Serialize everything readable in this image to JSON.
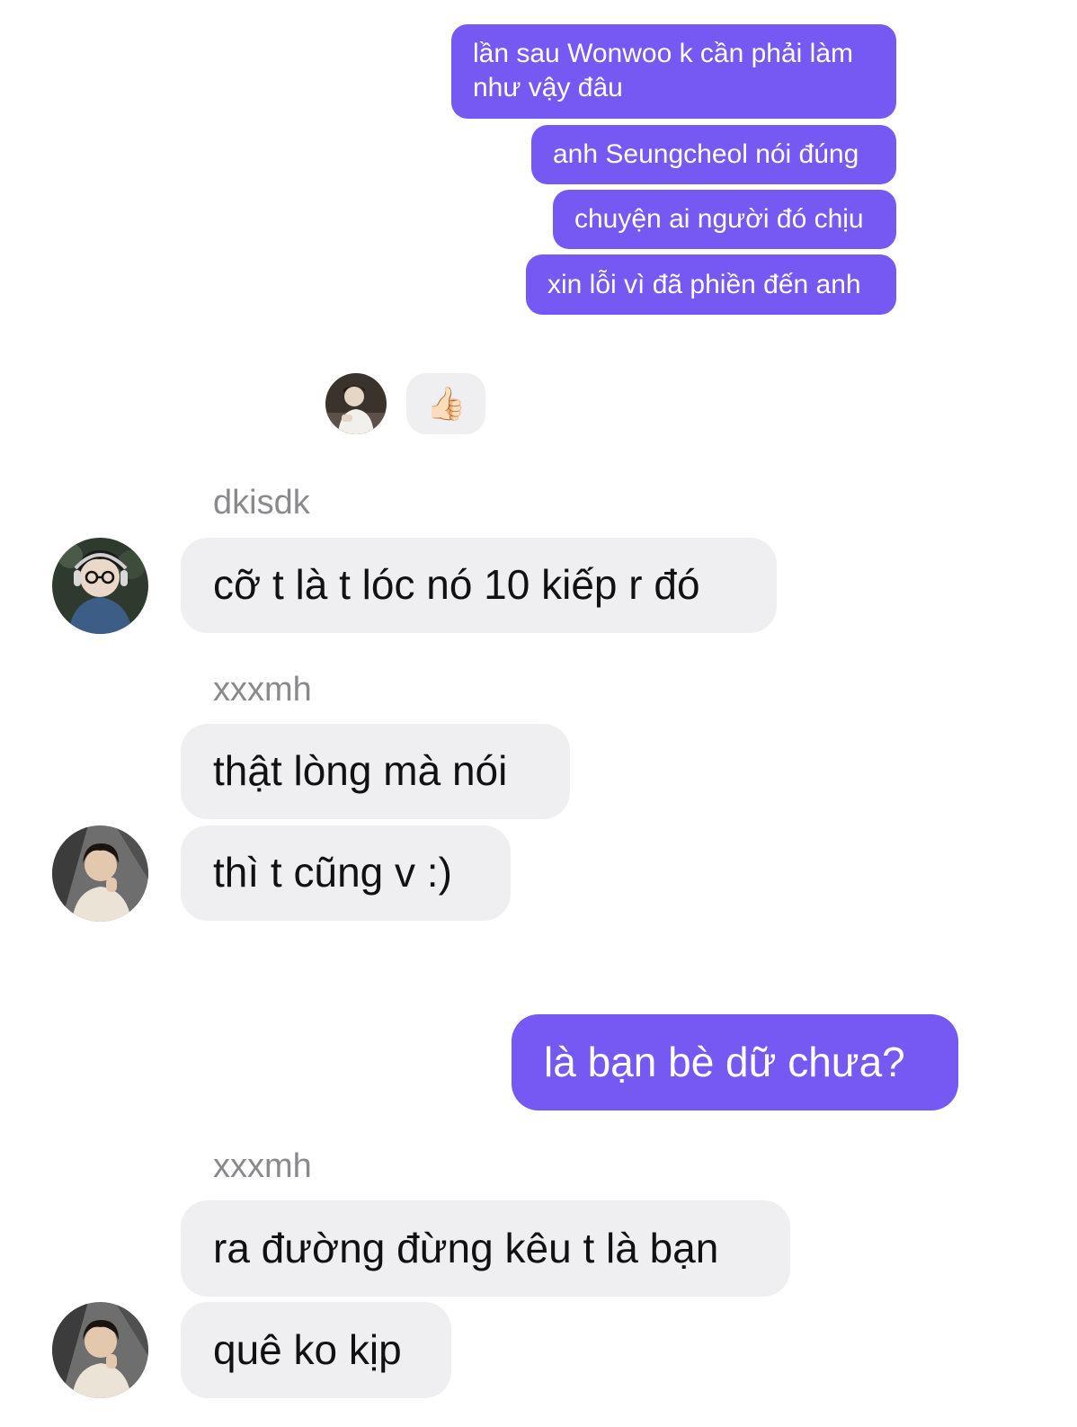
{
  "messages": {
    "m1": "lần sau Wonwoo k cần phải làm như vậy đâu",
    "m2": "anh Seungcheol nói đúng",
    "m3": "chuyện ai người đó chịu",
    "m4": "xin lỗi vì đã phiền đến anh",
    "m5": "cỡ t là t lóc nó 10 kiếp r đó",
    "m6": "thật lòng mà nói",
    "m7": "thì t cũng v :)",
    "m8": "là bạn bè dữ chưa?",
    "m9": "ra đường đừng kêu t là bạn",
    "m10": "quê ko kịp"
  },
  "senders": {
    "s1": "dkisdk",
    "s2": "xxxmh",
    "s3": "xxxmh"
  },
  "reaction": {
    "emoji": "👍🏻"
  },
  "colors": {
    "outgoing_bubble": "#7658f2",
    "incoming_bubble": "#efeff1",
    "sender_label": "#8a8a8e"
  }
}
